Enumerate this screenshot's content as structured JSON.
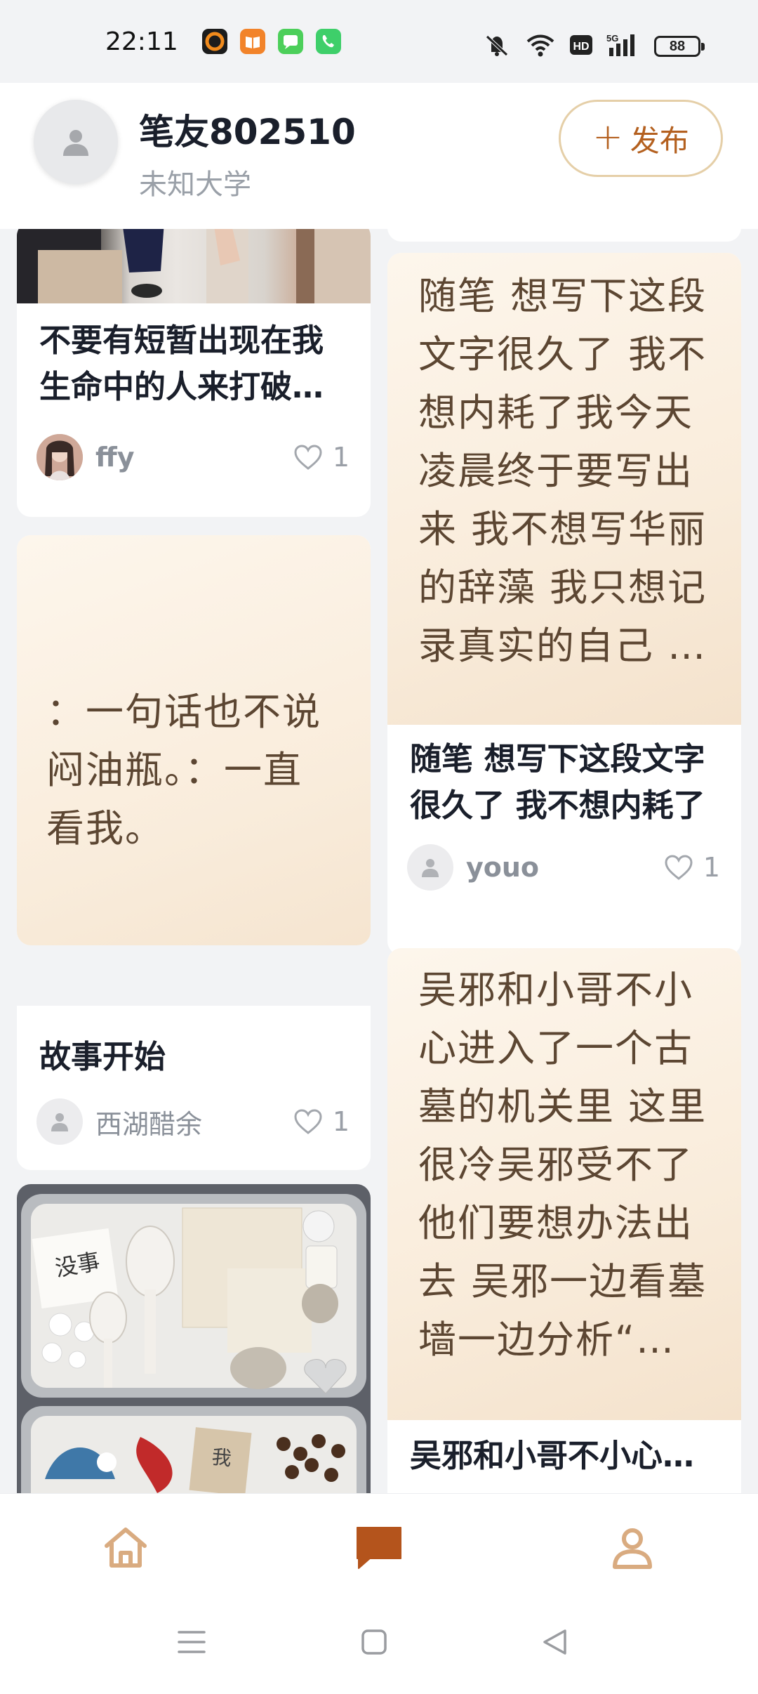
{
  "status_bar": {
    "time": "22:11",
    "battery": "88",
    "notification_icons": [
      "music-app-icon",
      "books-app-icon",
      "messages-app-icon",
      "phone-app-icon"
    ],
    "system_icons": [
      "mute-icon",
      "wifi-icon",
      "hd-icon",
      "5g-signal-icon",
      "battery-icon"
    ]
  },
  "header": {
    "title": "笔友802510",
    "subtitle": "未知大学",
    "publish_label": "发布"
  },
  "feed": {
    "left": [
      {
        "title": "不要有短暂出现在我生命中的人来打破我的平静",
        "author": "ffy",
        "likes": "1"
      },
      {
        "cover_text": "：一句话也不说 闷油瓶。：一直看我。",
        "title": "故事开始",
        "author": "西湖醋余",
        "likes": "1"
      },
      {
        "photo_text_1": "没事",
        "photo_text_2": "我"
      }
    ],
    "right": [
      {
        "cover_text": "随笔 想写下这段文字很久了 我不想内耗了我今天凌晨终于要写出来 我不想写华丽的辞藻 我只想记录真实的自己 …",
        "title": "随笔 想写下这段文字很久了 我不想内耗了",
        "author": "youo",
        "likes": "1"
      },
      {
        "cover_text": "吴邪和小哥不小心进入了一个古墓的机关里 这里很冷吴邪受不了他们要想办法出去 吴邪一边看墓墙一边分析“…",
        "title": "吴邪和小哥不小心进入了一个古墓的机关里"
      }
    ]
  },
  "colors": {
    "accent": "#b4601f",
    "cover_bg": "#fbf0e2",
    "nav_active": "#b4541c",
    "nav_inactive": "#d9ab80"
  },
  "bottom_nav": [
    "home-icon",
    "chat-icon",
    "profile-icon"
  ],
  "system_nav": [
    "menu-icon",
    "home-square-icon",
    "back-icon"
  ]
}
